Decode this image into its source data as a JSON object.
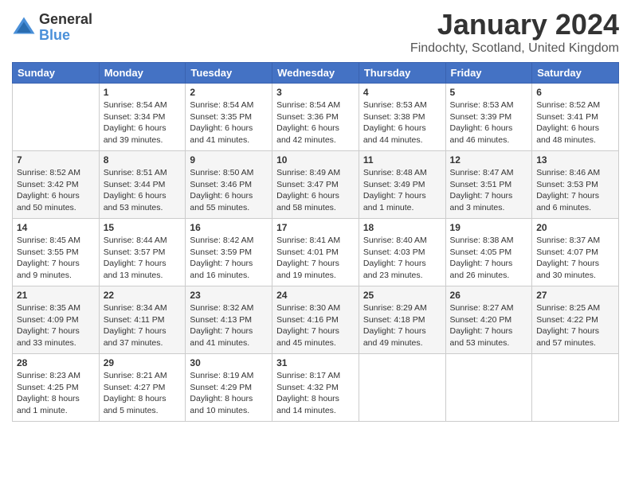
{
  "header": {
    "logo_general": "General",
    "logo_blue": "Blue",
    "month_title": "January 2024",
    "location": "Findochty, Scotland, United Kingdom"
  },
  "days_of_week": [
    "Sunday",
    "Monday",
    "Tuesday",
    "Wednesday",
    "Thursday",
    "Friday",
    "Saturday"
  ],
  "weeks": [
    [
      {
        "day": "",
        "info": ""
      },
      {
        "day": "1",
        "info": "Sunrise: 8:54 AM\nSunset: 3:34 PM\nDaylight: 6 hours\nand 39 minutes."
      },
      {
        "day": "2",
        "info": "Sunrise: 8:54 AM\nSunset: 3:35 PM\nDaylight: 6 hours\nand 41 minutes."
      },
      {
        "day": "3",
        "info": "Sunrise: 8:54 AM\nSunset: 3:36 PM\nDaylight: 6 hours\nand 42 minutes."
      },
      {
        "day": "4",
        "info": "Sunrise: 8:53 AM\nSunset: 3:38 PM\nDaylight: 6 hours\nand 44 minutes."
      },
      {
        "day": "5",
        "info": "Sunrise: 8:53 AM\nSunset: 3:39 PM\nDaylight: 6 hours\nand 46 minutes."
      },
      {
        "day": "6",
        "info": "Sunrise: 8:52 AM\nSunset: 3:41 PM\nDaylight: 6 hours\nand 48 minutes."
      }
    ],
    [
      {
        "day": "7",
        "info": "Sunrise: 8:52 AM\nSunset: 3:42 PM\nDaylight: 6 hours\nand 50 minutes."
      },
      {
        "day": "8",
        "info": "Sunrise: 8:51 AM\nSunset: 3:44 PM\nDaylight: 6 hours\nand 53 minutes."
      },
      {
        "day": "9",
        "info": "Sunrise: 8:50 AM\nSunset: 3:46 PM\nDaylight: 6 hours\nand 55 minutes."
      },
      {
        "day": "10",
        "info": "Sunrise: 8:49 AM\nSunset: 3:47 PM\nDaylight: 6 hours\nand 58 minutes."
      },
      {
        "day": "11",
        "info": "Sunrise: 8:48 AM\nSunset: 3:49 PM\nDaylight: 7 hours\nand 1 minute."
      },
      {
        "day": "12",
        "info": "Sunrise: 8:47 AM\nSunset: 3:51 PM\nDaylight: 7 hours\nand 3 minutes."
      },
      {
        "day": "13",
        "info": "Sunrise: 8:46 AM\nSunset: 3:53 PM\nDaylight: 7 hours\nand 6 minutes."
      }
    ],
    [
      {
        "day": "14",
        "info": "Sunrise: 8:45 AM\nSunset: 3:55 PM\nDaylight: 7 hours\nand 9 minutes."
      },
      {
        "day": "15",
        "info": "Sunrise: 8:44 AM\nSunset: 3:57 PM\nDaylight: 7 hours\nand 13 minutes."
      },
      {
        "day": "16",
        "info": "Sunrise: 8:42 AM\nSunset: 3:59 PM\nDaylight: 7 hours\nand 16 minutes."
      },
      {
        "day": "17",
        "info": "Sunrise: 8:41 AM\nSunset: 4:01 PM\nDaylight: 7 hours\nand 19 minutes."
      },
      {
        "day": "18",
        "info": "Sunrise: 8:40 AM\nSunset: 4:03 PM\nDaylight: 7 hours\nand 23 minutes."
      },
      {
        "day": "19",
        "info": "Sunrise: 8:38 AM\nSunset: 4:05 PM\nDaylight: 7 hours\nand 26 minutes."
      },
      {
        "day": "20",
        "info": "Sunrise: 8:37 AM\nSunset: 4:07 PM\nDaylight: 7 hours\nand 30 minutes."
      }
    ],
    [
      {
        "day": "21",
        "info": "Sunrise: 8:35 AM\nSunset: 4:09 PM\nDaylight: 7 hours\nand 33 minutes."
      },
      {
        "day": "22",
        "info": "Sunrise: 8:34 AM\nSunset: 4:11 PM\nDaylight: 7 hours\nand 37 minutes."
      },
      {
        "day": "23",
        "info": "Sunrise: 8:32 AM\nSunset: 4:13 PM\nDaylight: 7 hours\nand 41 minutes."
      },
      {
        "day": "24",
        "info": "Sunrise: 8:30 AM\nSunset: 4:16 PM\nDaylight: 7 hours\nand 45 minutes."
      },
      {
        "day": "25",
        "info": "Sunrise: 8:29 AM\nSunset: 4:18 PM\nDaylight: 7 hours\nand 49 minutes."
      },
      {
        "day": "26",
        "info": "Sunrise: 8:27 AM\nSunset: 4:20 PM\nDaylight: 7 hours\nand 53 minutes."
      },
      {
        "day": "27",
        "info": "Sunrise: 8:25 AM\nSunset: 4:22 PM\nDaylight: 7 hours\nand 57 minutes."
      }
    ],
    [
      {
        "day": "28",
        "info": "Sunrise: 8:23 AM\nSunset: 4:25 PM\nDaylight: 8 hours\nand 1 minute."
      },
      {
        "day": "29",
        "info": "Sunrise: 8:21 AM\nSunset: 4:27 PM\nDaylight: 8 hours\nand 5 minutes."
      },
      {
        "day": "30",
        "info": "Sunrise: 8:19 AM\nSunset: 4:29 PM\nDaylight: 8 hours\nand 10 minutes."
      },
      {
        "day": "31",
        "info": "Sunrise: 8:17 AM\nSunset: 4:32 PM\nDaylight: 8 hours\nand 14 minutes."
      },
      {
        "day": "",
        "info": ""
      },
      {
        "day": "",
        "info": ""
      },
      {
        "day": "",
        "info": ""
      }
    ]
  ]
}
